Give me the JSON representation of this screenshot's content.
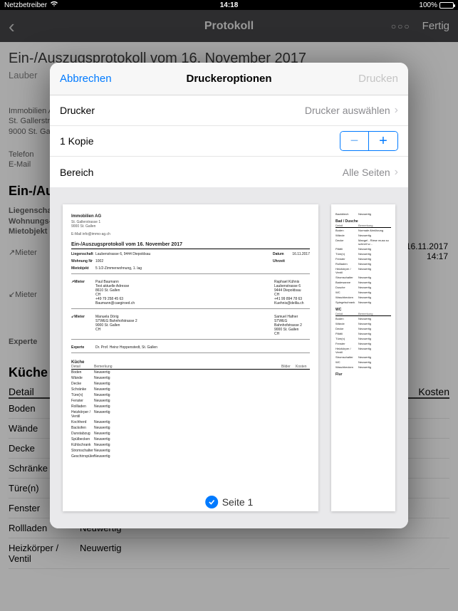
{
  "statusbar": {
    "carrier": "Netzbetreiber",
    "time": "14:18",
    "battery": "100%"
  },
  "navbar": {
    "title": "Protokoll",
    "done": "Fertig"
  },
  "background": {
    "title": "Ein-/Auszugsprotokoll vom 16. November 2017",
    "subtitle": "Lauber",
    "addr1": "Immobilien A",
    "addr2": "St. Gallerstrass",
    "addr3": "9000 St. Gall",
    "tel_label": "Telefon",
    "mail_label": "E-Mail",
    "sectitle": "Ein-/Au",
    "row1": "Liegenschaf",
    "row2": "Wohnungs-N",
    "row3": "Mietobjekt",
    "mieter_in": "↗Mieter",
    "mieter_out": "↙Mieter",
    "experte": "Experte",
    "kuche": "Küche",
    "col_detail": "Detail",
    "col_kosten": "Kosten",
    "date": "16.11.2017",
    "time": "14:17",
    "rows": [
      {
        "d": "Boden",
        "b": ""
      },
      {
        "d": "Wände",
        "b": ""
      },
      {
        "d": "Decke",
        "b": ""
      },
      {
        "d": "Schränke",
        "b": ""
      },
      {
        "d": "Türe(n)",
        "b": ""
      },
      {
        "d": "Fenster",
        "b": "Neuwertig"
      },
      {
        "d": "Rollladen",
        "b": "Neuwertig"
      },
      {
        "d": "Heizkörper / Ventil",
        "b": "Neuwertig"
      }
    ]
  },
  "modal": {
    "cancel": "Abbrechen",
    "title": "Druckeroptionen",
    "print": "Drucken",
    "printer_label": "Drucker",
    "printer_value": "Drucker auswählen",
    "copies_label": "1 Kopie",
    "range_label": "Bereich",
    "range_value": "Alle Seiten",
    "page_label": "Seite 1"
  },
  "preview": {
    "company": "Immobilien AG",
    "addr1": "St. Gallerstrasse 1",
    "addr2": "9000 St. Gallen",
    "email": "E-Mail    info@immo-ag.ch",
    "title": "Ein-/Auszugsprotokoll vom 16. November 2017",
    "lg_label": "Liegenschaft",
    "lg_val": "Laubenstrasse 6, 9444 Diepoldsau",
    "wn_label": "Wohnung Nr",
    "wn_val": "1002",
    "mo_label": "Mietobjekt",
    "mo_val": "5 1/2-Zimmerwohnung, 1. lag",
    "datum_label": "Datum",
    "datum_val": "16.11.2017",
    "uhr_label": "Uhrzeit",
    "mieter_in_label": "↗Mieter",
    "m1_name": "Paul Baumann",
    "m1_l1": "Test aktuelle Adresse",
    "m1_l2": "8610 St. Gallen",
    "m1_l3": "CH",
    "m1_l4": "+49 79 258 45 63",
    "m1_l5": "Baumann@caegiroed.ch",
    "m2_name": "Raphael Kühnis",
    "m2_l1": "Laubenstrasse 6",
    "m2_l2": "9444 Diepoldsau",
    "m2_l3": "CH",
    "m2_l4": "+41 99 894 78 63",
    "m2_l5": "Kuehnis@delila.ch",
    "mieter_out_label": "↙Mieter",
    "m3_name": "Manuela Dörig",
    "m3_l1": "STWEG Bahnhofstrasse 2",
    "m3_l2": "9000 St. Gallen",
    "m3_l3": "CH",
    "m4_name": "Samuel Hafner",
    "m4_l1": "STWEG Bahnhofstrasse 2",
    "m4_l2": "9000 St. Gallen",
    "m4_l3": "CH",
    "exp_label": "Experte",
    "exp_val": "Dr. Prof. Heinz Hoppenstedt, St. Gallen",
    "kuche": "Küche",
    "th_detail": "Detail",
    "th_bem": "Bemerkung",
    "th_bilder": "Bilder",
    "th_kosten": "Kosten",
    "kuche_rows": [
      {
        "d": "Boden",
        "b": "Neuwertig"
      },
      {
        "d": "Wände",
        "b": "Neuwertig"
      },
      {
        "d": "Decke",
        "b": "Neuwertig"
      },
      {
        "d": "Schränke",
        "b": "Neuwertig"
      },
      {
        "d": "Türe(n)",
        "b": "Neuwertig"
      },
      {
        "d": "Fenster",
        "b": "Neuwertig"
      },
      {
        "d": "Rollladen",
        "b": "Neuwertig"
      },
      {
        "d": "Heizkörper / Ventil",
        "b": "Neuwertig"
      },
      {
        "d": "Kochherd",
        "b": "Neuwertig"
      },
      {
        "d": "Backofen",
        "b": "Neuwertig"
      },
      {
        "d": "Dunstabzug",
        "b": "Neuwertig"
      },
      {
        "d": "Spülbecken",
        "b": "Neuwertig"
      },
      {
        "d": "Kühlschrank",
        "b": "Neuwertig"
      },
      {
        "d": "Stromschalter",
        "b": "Neuwertig"
      },
      {
        "d": "Geschirrspüler",
        "b": "Neuwertig"
      }
    ]
  },
  "preview2": {
    "backblech": {
      "d": "Backblech",
      "b": "Neuwertig"
    },
    "bad": "Bad / Dusche",
    "th_detail": "Detail",
    "th_bem": "Bemerkung",
    "bad_rows": [
      {
        "d": "Boden",
        "b": "Normale Abnützung"
      },
      {
        "d": "Wände",
        "b": "Neuwertig"
      },
      {
        "d": "Decke",
        "b": "Mangel - Riese muss so schnell w…"
      },
      {
        "d": "Plättli",
        "b": "Neuwertig"
      },
      {
        "d": "Türe(n)",
        "b": "Neuwertig"
      },
      {
        "d": "Fenster",
        "b": "Neuwertig"
      },
      {
        "d": "Rollladen",
        "b": "Neuwertig"
      },
      {
        "d": "Heizkörper / Ventil",
        "b": "Neuwertig"
      },
      {
        "d": "Stromschalter",
        "b": "Neuwertig"
      },
      {
        "d": "Badewanne",
        "b": "Neuwertig"
      },
      {
        "d": "Dusche",
        "b": "Neuwertig"
      },
      {
        "d": "WC",
        "b": "Neuwertig"
      },
      {
        "d": "Waschbecken",
        "b": "Neuwertig"
      },
      {
        "d": "Spiegelschrank",
        "b": "Neuwertig"
      }
    ],
    "wc": "WC",
    "wc_rows": [
      {
        "d": "Boden",
        "b": "Neuwertig"
      },
      {
        "d": "Wände",
        "b": "Neuwertig"
      },
      {
        "d": "Decke",
        "b": "Neuwertig"
      },
      {
        "d": "Plättli",
        "b": "Neuwertig"
      },
      {
        "d": "Türe(n)",
        "b": "Neuwertig"
      },
      {
        "d": "Fenster",
        "b": "Neuwertig"
      },
      {
        "d": "Heizkörper / Ventil",
        "b": "Neuwertig"
      },
      {
        "d": "Stromschalter",
        "b": "Neuwertig"
      },
      {
        "d": "WC",
        "b": "Neuwertig"
      },
      {
        "d": "Waschbecken",
        "b": "Neuwertig"
      }
    ],
    "flur": "Flur"
  }
}
